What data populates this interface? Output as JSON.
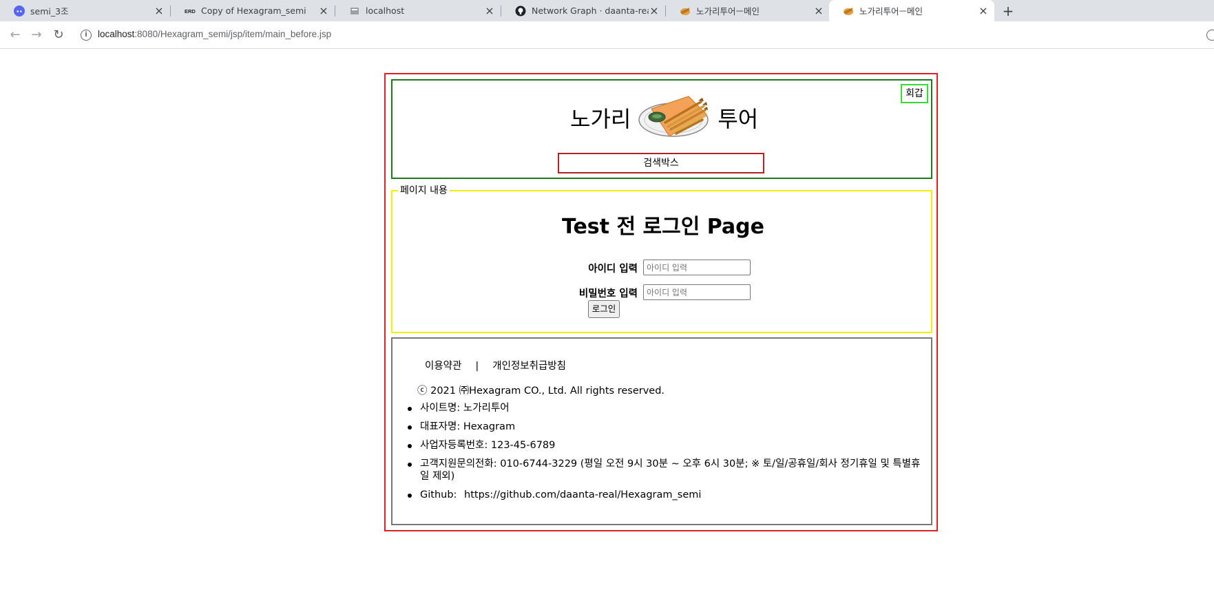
{
  "browser": {
    "tabs": [
      {
        "title": "semi_3조",
        "icon": "discord-icon",
        "active": false
      },
      {
        "title": "Copy of Hexagram_semi",
        "icon": "erd-icon",
        "active": false
      },
      {
        "title": "localhost",
        "icon": "page-icon",
        "active": false
      },
      {
        "title": "Network Graph · daanta-real/He",
        "icon": "github-icon",
        "active": false
      },
      {
        "title": "노가리투어ㅡ메인",
        "icon": "nogari-icon",
        "active": false
      },
      {
        "title": "노가리투어ㅡ메인",
        "icon": "nogari-icon",
        "active": true
      }
    ],
    "new_tab": "+",
    "url_host": "localhost",
    "url_path": ":8080/Hexagram_semi/jsp/item/main_before.jsp"
  },
  "header": {
    "badge": "회갑",
    "logo_left": "노가리",
    "logo_right": "투어",
    "search_box": "검색박스"
  },
  "content": {
    "legend": "페이지 내용",
    "title": "Test 전 로그인 Page",
    "id_label": "아이디 입력",
    "id_placeholder": "아이디 입력",
    "pw_label": "비밀번호 입력",
    "pw_placeholder": "아이디 입력",
    "login_button": "로그인"
  },
  "footer": {
    "terms": "이용약관",
    "separator": "|",
    "privacy": "개인정보취급방침",
    "copyright": "ⓒ 2021 ㈜Hexagram CO., Ltd. All rights reserved.",
    "items": [
      "사이트명: 노가리투어",
      "대표자명: Hexagram",
      "사업자등록번호: 123-45-6789",
      "고객지원문의전화: 010-6744-3229 (평일 오전 9시 30분 ~ 오후 6시 30분; ※ 토/일/공휴일/회사 정기휴일 및 특별휴일 제외)"
    ],
    "github_label": "Github:",
    "github_url": "https://github.com/daanta-real/Hexagram_semi"
  },
  "colors": {
    "page_border": "#e02020",
    "header_border": "#1a7a1a",
    "badge_border": "#33dd33",
    "search_border": "#b22222",
    "content_border": "#f0f000",
    "footer_border": "#777777"
  }
}
